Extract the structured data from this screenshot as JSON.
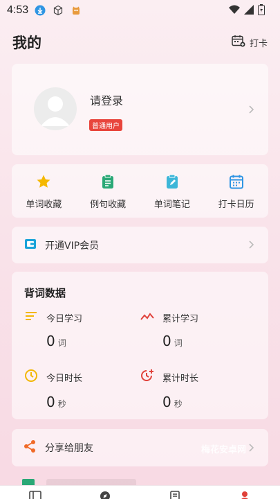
{
  "status": {
    "time": "4:53"
  },
  "header": {
    "title": "我的",
    "checkin_label": "打卡"
  },
  "profile": {
    "login_text": "请登录",
    "badge": "普通用户"
  },
  "shortcuts": [
    {
      "label": "单词收藏",
      "icon": "star-icon",
      "color": "#f5b800"
    },
    {
      "label": "例句收藏",
      "icon": "clipboard-icon",
      "color": "#2aa876"
    },
    {
      "label": "单词笔记",
      "icon": "note-icon",
      "color": "#3cb6d8"
    },
    {
      "label": "打卡日历",
      "icon": "calendar-icon",
      "color": "#2f95e3"
    }
  ],
  "vip": {
    "label": "开通VIP会员",
    "icon": "wallet-icon",
    "color": "#1aa3d9"
  },
  "stats": {
    "title": "背词数据",
    "items": [
      {
        "label": "今日学习",
        "value": "0",
        "unit": "词",
        "icon": "list-icon",
        "color": "#f2b705"
      },
      {
        "label": "累计学习",
        "value": "0",
        "unit": "词",
        "icon": "trend-icon",
        "color": "#e0413a"
      },
      {
        "label": "今日时长",
        "value": "0",
        "unit": "秒",
        "icon": "clock-icon",
        "color": "#f2b705"
      },
      {
        "label": "累计时长",
        "value": "0",
        "unit": "秒",
        "icon": "clock-plus-icon",
        "color": "#e0413a"
      }
    ]
  },
  "share": {
    "label": "分享给朋友",
    "icon": "share-icon",
    "color": "#f06a28"
  },
  "watermark": "梅花安卓网",
  "colors": {
    "accent": "#e0413a",
    "background": "#f9e3ea"
  }
}
